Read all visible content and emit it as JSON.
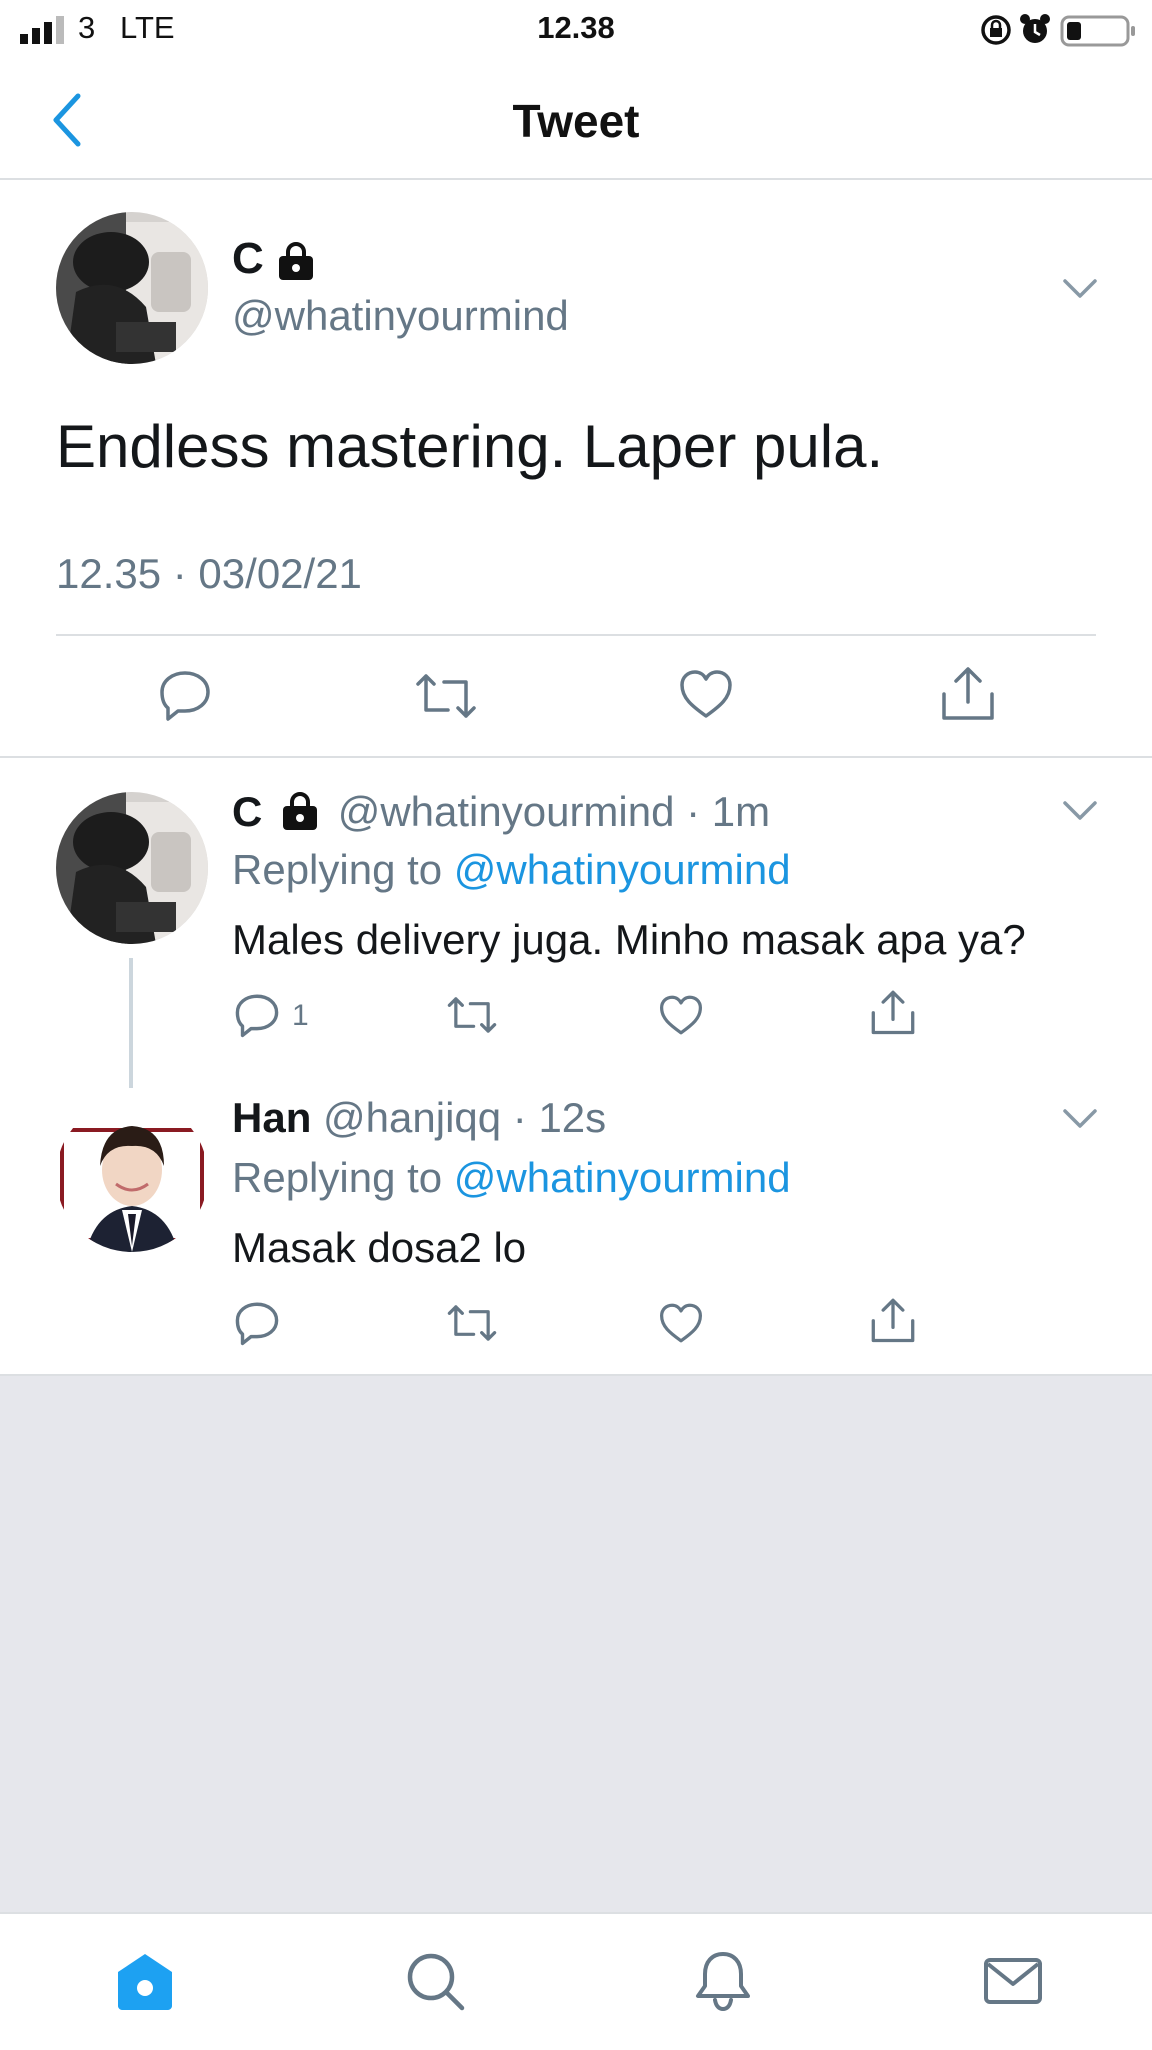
{
  "status_bar": {
    "carrier": "3",
    "network": "LTE",
    "time": "12.38"
  },
  "nav": {
    "title": "Tweet",
    "back_icon": "chevron-left-icon"
  },
  "main_tweet": {
    "name": "C",
    "handle": "@whatinyourmind",
    "text": "Endless mastering. Laper pula.",
    "timestamp": "12.35 · 03/02/21"
  },
  "replies": [
    {
      "name": "C",
      "handle": "@whatinyourmind",
      "time": "· 1m",
      "replying_prefix": "Replying to ",
      "replying_to": "@whatinyourmind",
      "text": "Males delivery juga. Minho masak apa ya?",
      "reply_count": "1"
    },
    {
      "name": "Han",
      "handle": "@hanjiqq",
      "time": "· 12s",
      "replying_prefix": "Replying to ",
      "replying_to": "@whatinyourmind",
      "text": "Masak dosa2 lo",
      "reply_count": ""
    }
  ],
  "tabs": [
    "home-icon",
    "search-icon",
    "bell-icon",
    "mail-icon"
  ],
  "colors": {
    "accent": "#1b95e0",
    "tab_active": "#1da1f2",
    "secondary_text": "#657786",
    "icon_grey": "#657786",
    "background_grey": "#e6e7ec"
  }
}
